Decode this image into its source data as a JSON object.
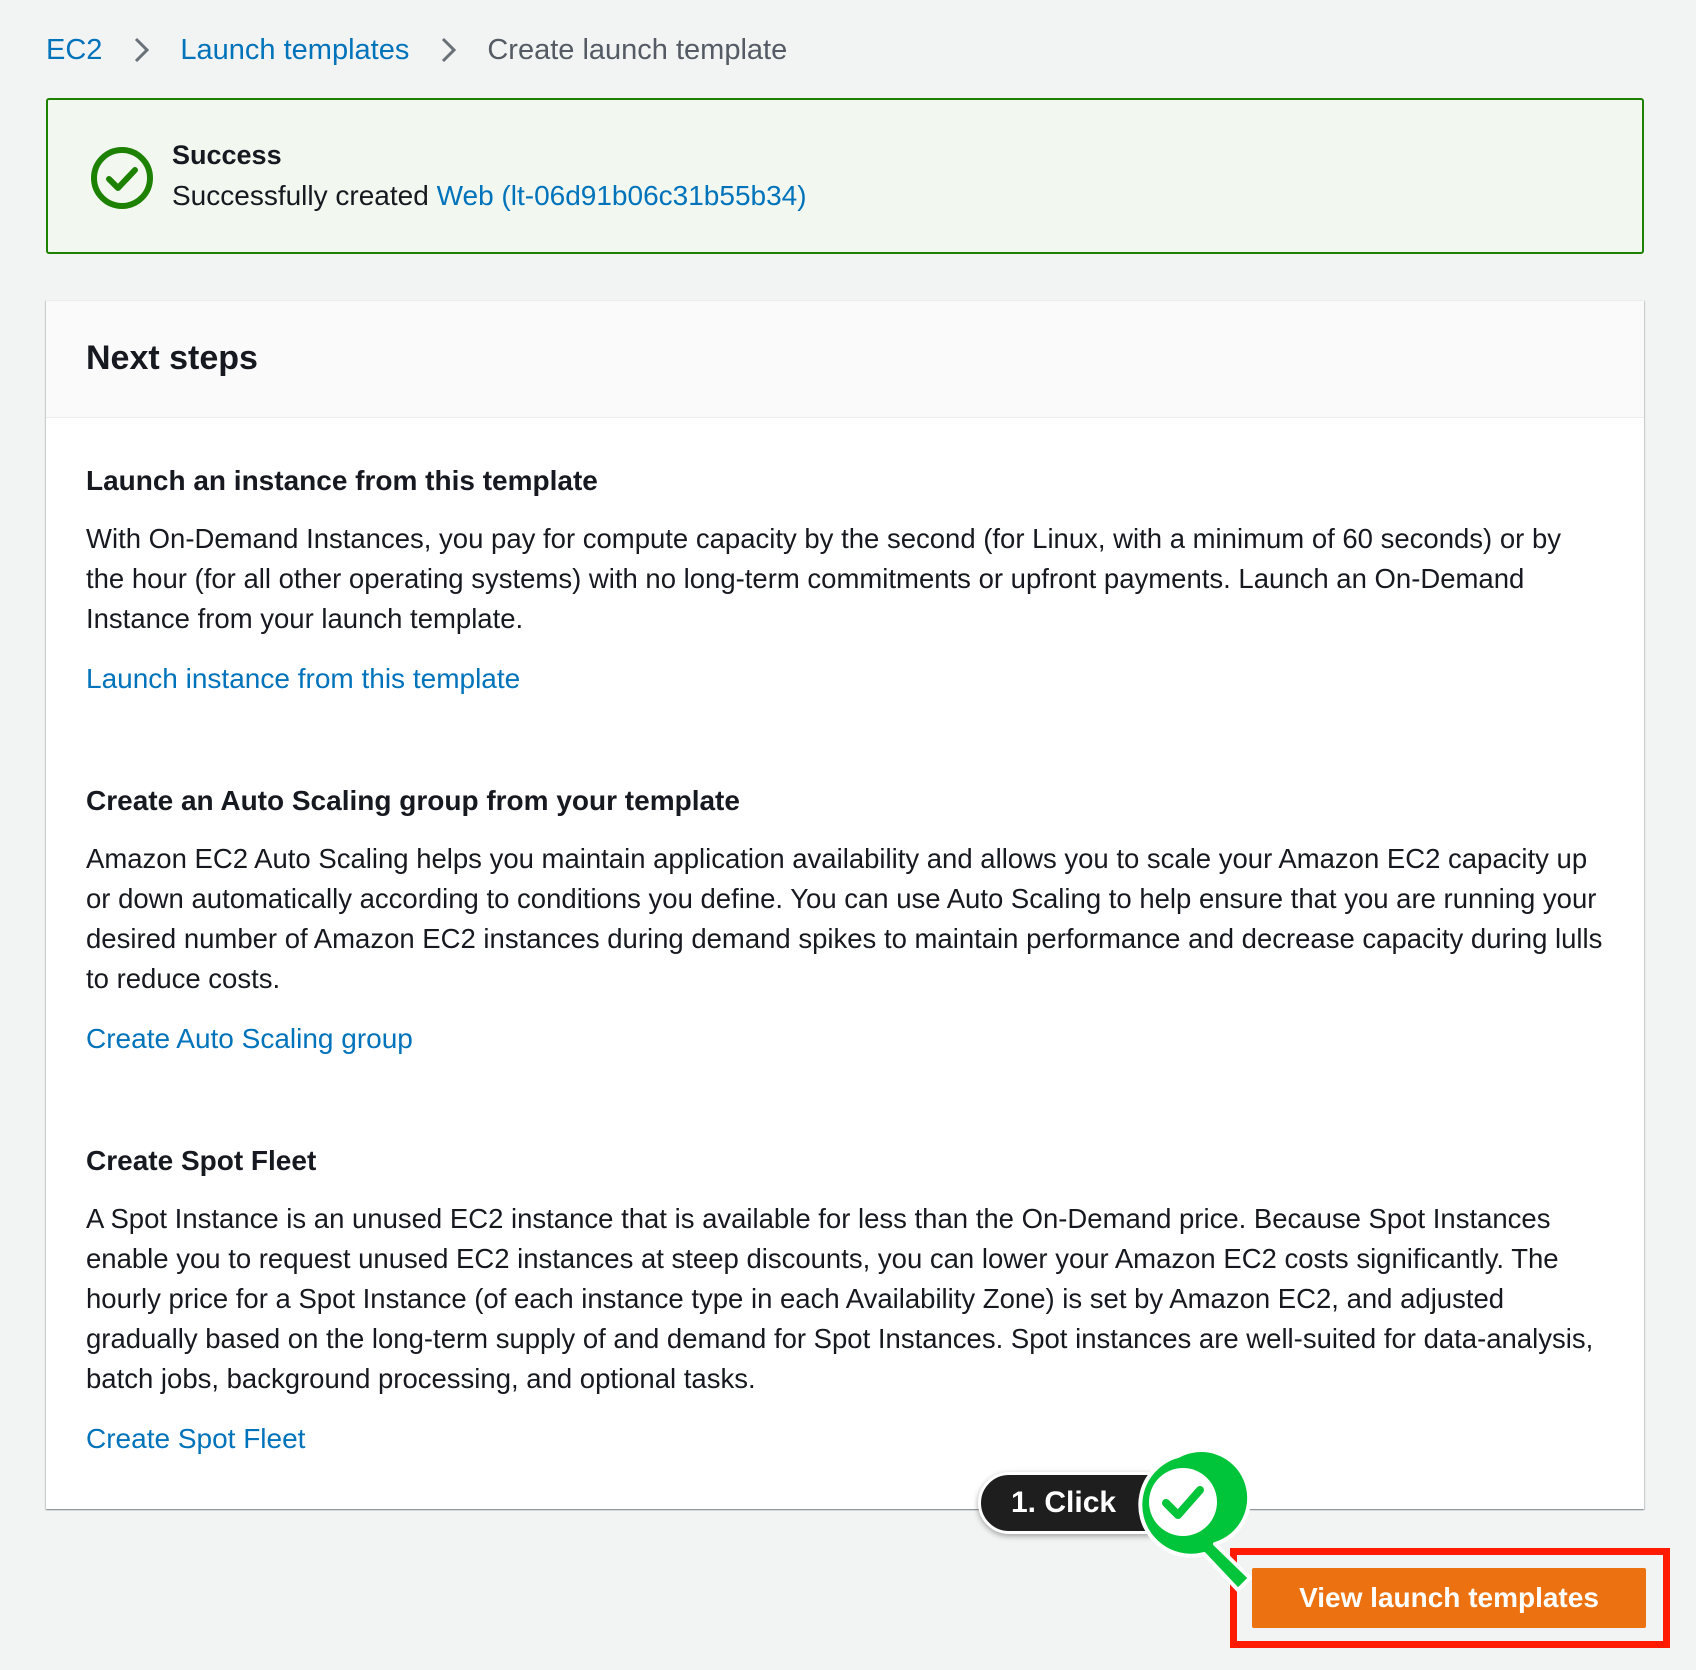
{
  "breadcrumb": {
    "items": [
      "EC2",
      "Launch templates"
    ],
    "current": "Create launch template"
  },
  "flash": {
    "title": "Success",
    "message_prefix": "Successfully created ",
    "link_text": "Web (lt-06d91b06c31b55b34)",
    "color": "#1d8102"
  },
  "panel": {
    "title": "Next steps",
    "sections": [
      {
        "title": "Launch an instance from this template",
        "body": "With On-Demand Instances, you pay for compute capacity by the second (for Linux, with a minimum of 60 seconds) or by the hour (for all other operating systems) with no long-term commitments or upfront payments. Launch an On-Demand Instance from your launch template.",
        "link": "Launch instance from this template"
      },
      {
        "title": "Create an Auto Scaling group from your template",
        "body": "Amazon EC2 Auto Scaling helps you maintain application availability and allows you to scale your Amazon EC2 capacity up or down automatically according to conditions you define. You can use Auto Scaling to help ensure that you are running your desired number of Amazon EC2 instances during demand spikes to maintain performance and decrease capacity during lulls to reduce costs.",
        "link": "Create Auto Scaling group"
      },
      {
        "title": "Create Spot Fleet",
        "body": "A Spot Instance is an unused EC2 instance that is available for less than the On-Demand price. Because Spot Instances enable you to request unused EC2 instances at steep discounts, you can lower your Amazon EC2 costs significantly. The hourly price for a Spot Instance (of each instance type in each Availability Zone) is set by Amazon EC2, and adjusted gradually based on the long-term supply of and demand for Spot Instances. Spot instances are well-suited for data-analysis, batch jobs, background processing, and optional tasks.",
        "link": "Create Spot Fleet"
      }
    ]
  },
  "actions": {
    "primary_label": "View launch templates",
    "primary_color": "#ec7211"
  },
  "annotation": {
    "step_label": "1. Click",
    "highlight_color": "#ff1a00",
    "marker_color": "#00c43a"
  },
  "icons": {
    "breadcrumb_separator": "chevron-right-icon",
    "flash_status": "success-check-icon",
    "annotation_marker": "check-marker-icon"
  }
}
